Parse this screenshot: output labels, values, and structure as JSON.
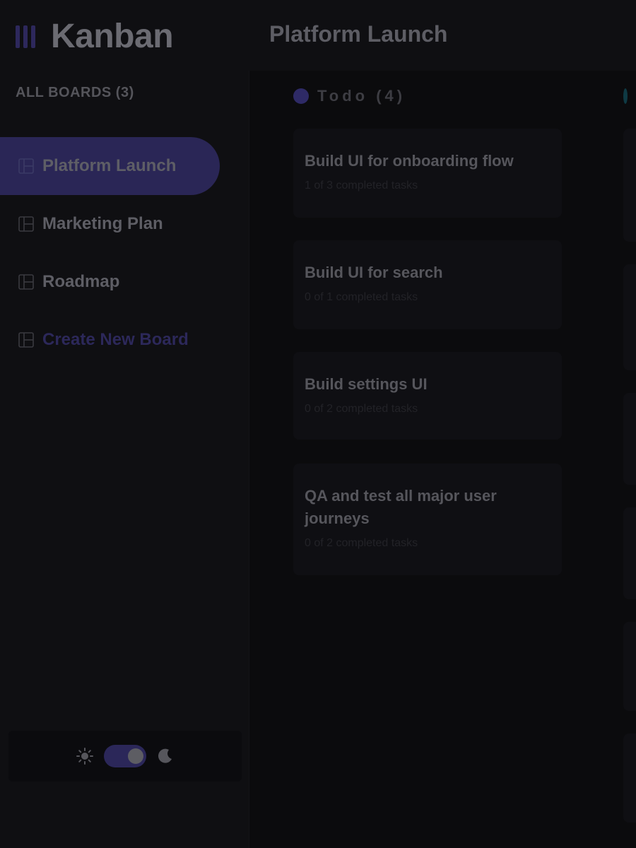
{
  "app": {
    "logo_text": "Kanban",
    "board_title": "Platform Launch"
  },
  "sidebar": {
    "heading": "ALL BOARDS (3)",
    "boards": [
      {
        "label": "Platform Launch",
        "active": true
      },
      {
        "label": "Marketing Plan",
        "active": false
      },
      {
        "label": "Roadmap",
        "active": false
      }
    ],
    "create_label": "Create New Board"
  },
  "theme": {
    "light_icon": "sun-icon",
    "dark_icon": "moon-icon",
    "mode": "dark"
  },
  "columns": [
    {
      "title": "Todo (4)",
      "dot_color": "#2e2a66",
      "cards": [
        {
          "title": "Build UI for onboarding flow",
          "subtitle": "1 of 3 completed tasks"
        },
        {
          "title": "Build UI for search",
          "subtitle": "0 of 1 completed tasks"
        },
        {
          "title": "Build settings UI",
          "subtitle": "0 of 2 completed tasks"
        },
        {
          "title": "QA and test all major user journeys",
          "subtitle": "0 of 2 completed tasks"
        }
      ]
    },
    {
      "title": "",
      "dot_color": "#0f3a44"
    }
  ],
  "colors": {
    "accent": "#2a2656",
    "background": "#0b0b0d"
  }
}
